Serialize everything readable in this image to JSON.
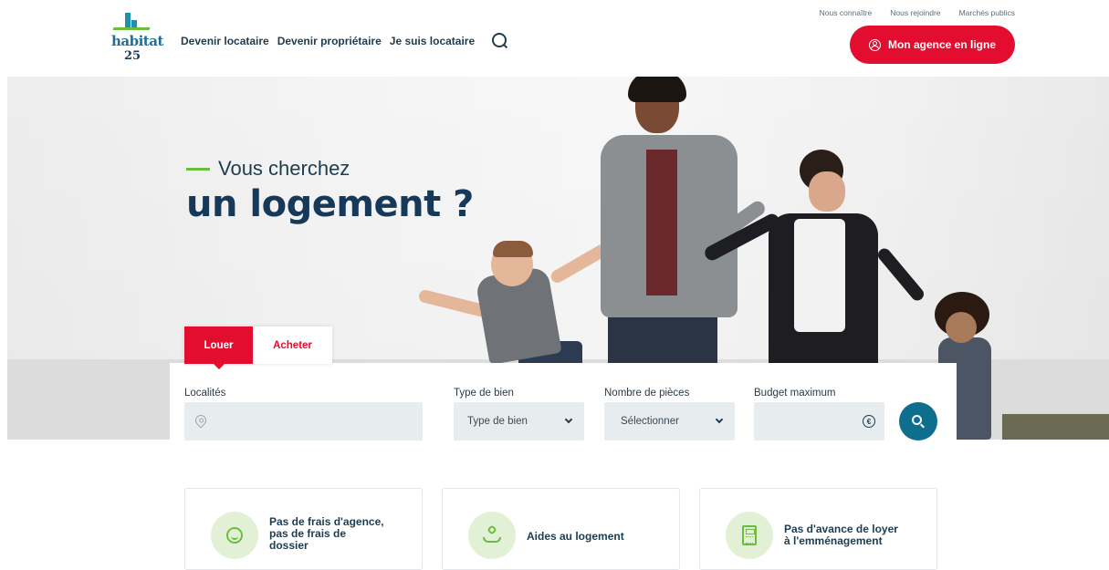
{
  "header": {
    "logo": {
      "word": "habitat",
      "number": "25"
    },
    "nav": [
      "Devenir locataire",
      "Devenir propriétaire",
      "Je suis locataire"
    ],
    "top_links": [
      "Nous connaître",
      "Nous rejoindre",
      "Marchés publics"
    ],
    "agency_button": "Mon agence en ligne"
  },
  "hero": {
    "kicker": "Vous cherchez",
    "title": "un logement ?"
  },
  "tabs": [
    "Louer",
    "Acheter"
  ],
  "search": {
    "localites": {
      "label": "Localités",
      "value": ""
    },
    "type": {
      "label": "Type de bien",
      "value": "Type de bien"
    },
    "pieces": {
      "label": "Nombre de pièces",
      "value": "Sélectionner"
    },
    "budget": {
      "label": "Budget maximum",
      "value": ""
    }
  },
  "features": [
    {
      "line1": "Pas de frais d'agence,",
      "line2": "pas de frais de",
      "line3": "dossier",
      "icon": "smile-icon"
    },
    {
      "line1": "Aides au logement",
      "line2": "",
      "line3": "",
      "icon": "hand-heart-icon"
    },
    {
      "line1": "Pas d'avance de loyer",
      "line2": "à l'emménagement",
      "line3": "",
      "icon": "calculator-icon"
    }
  ],
  "colors": {
    "brand_red": "#e30d2f",
    "brand_blue": "#0f6d8e",
    "brand_green": "#6bbd3f",
    "navy": "#1d3c50"
  }
}
